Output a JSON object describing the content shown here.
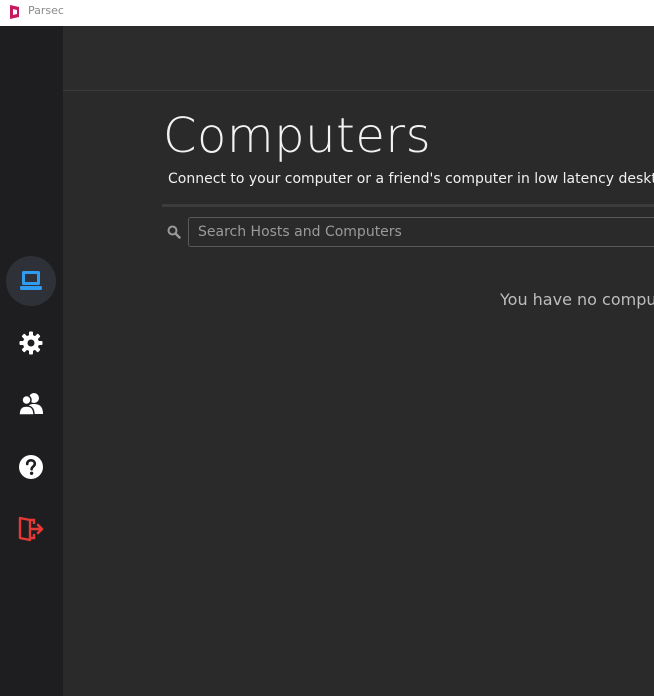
{
  "window": {
    "title": "Parsec"
  },
  "colors": {
    "accent_blue": "#2f9cf0",
    "logout_red": "#e53935",
    "logo_pink": "#c8185f"
  },
  "sidebar": {
    "items": [
      {
        "name": "computers",
        "icon": "laptop-icon",
        "active": true
      },
      {
        "name": "settings",
        "icon": "gear-icon",
        "active": false
      },
      {
        "name": "friends",
        "icon": "users-icon",
        "active": false
      },
      {
        "name": "help",
        "icon": "question-icon",
        "active": false
      },
      {
        "name": "logout",
        "icon": "logout-icon",
        "active": false
      }
    ]
  },
  "main": {
    "title": "Computers",
    "subtitle": "Connect to your computer or a friend's computer in low latency desktop m",
    "search": {
      "placeholder": "Search Hosts and Computers",
      "value": ""
    },
    "empty_message": "You have no compu"
  }
}
